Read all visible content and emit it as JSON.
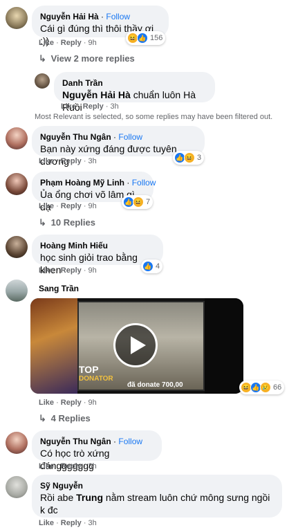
{
  "comments": [
    {
      "name": "Nguyễn Hải Hà",
      "follow": "Follow",
      "text": "Cái gì đúng thì thôi thầy ơi :))",
      "reactions": [
        "haha-icon",
        "like-icon"
      ],
      "count": "156",
      "like": "Like",
      "reply": "Reply",
      "time": "9h"
    },
    {
      "name": "Nguyễn Thu Ngân",
      "follow": "Follow",
      "text": "Bạn này xứng đáng được tuyên dương",
      "reactions": [
        "like-icon",
        "haha-icon"
      ],
      "count": "3",
      "like": "Like",
      "reply": "Reply",
      "time": "3h"
    },
    {
      "name": "Phạm Hoàng Mỹ Linh",
      "follow": "Follow",
      "text": "Ủa ổng chơi võ lâm gì dạ",
      "reactions": [
        "like-icon",
        "haha-icon"
      ],
      "count": "7",
      "like": "Like",
      "reply": "Reply",
      "time": "9h"
    },
    {
      "name": "Hoàng Minh Hiếu",
      "text": "học sinh giỏi trao bằng khen",
      "reactions": [
        "like-icon"
      ],
      "count": "4",
      "like": "Like",
      "reply": "Reply",
      "time": "9h"
    },
    {
      "name": "Sang Trần",
      "reactions": [
        "haha-icon",
        "like-icon",
        "sad-icon"
      ],
      "count": "66",
      "like": "Like",
      "reply": "Reply",
      "time": "9h"
    },
    {
      "name": "Nguyễn Thu Ngân",
      "follow": "Follow",
      "text": "Có học trò xứng đánggggggg",
      "like": "Like",
      "reply": "Reply",
      "time": "3h"
    },
    {
      "name": "Sỹ Nguyễn",
      "text_pre": "Rồi abe ",
      "text_bold": "Trung",
      "text_post": " nằm stream luôn chứ mông sưng ngồi k đc",
      "like": "Like",
      "reply": "Reply",
      "time": "3h"
    }
  ],
  "view_more_replies": "View 2 more replies",
  "nested_reply": {
    "name": "Danh Trần",
    "mention": "Nguyễn Hải Hà",
    "text": " chuẩn luôn Hà Ruồi",
    "like": "Like",
    "reply": "Reply",
    "time": "3h"
  },
  "filter_note": "Most Relevant is selected, so some replies may have been filtered out.",
  "replies_10": "10 Replies",
  "replies_4": "4 Replies",
  "video": {
    "badge_top": "TOP",
    "badge_donator": "DONATOR",
    "donate_text": "đã donate 700,00"
  },
  "colors": {
    "accent": "#1877f2",
    "bubble": "#f0f2f5",
    "secondary_text": "#65676b"
  }
}
